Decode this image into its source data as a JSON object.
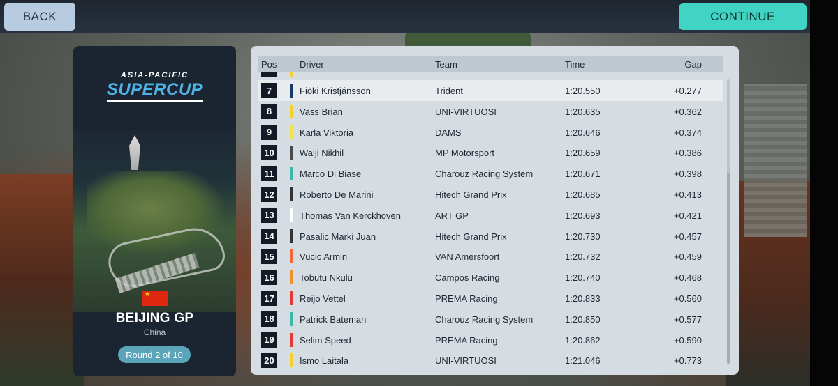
{
  "nav": {
    "back_label": "BACK",
    "continue_label": "CONTINUE"
  },
  "event": {
    "series_top": "ASIA-PACIFIC",
    "series_name": "SUPERCUP",
    "gp_name": "BEIJING GP",
    "country": "China",
    "round": "Round 2 of 10"
  },
  "colors": {
    "continue": "#41d3c3",
    "back": "#b8cce1",
    "series_blue": "#4fb3e6",
    "round_badge": "#5aa5ba"
  },
  "table": {
    "headers": {
      "pos": "Pos",
      "driver": "Driver",
      "team": "Team",
      "time": "Time",
      "gap": "Gap"
    },
    "rows": [
      {
        "pos": "7",
        "driver": "Fiòki Kristjánsson",
        "team": "Trident",
        "time": "1:20.550",
        "gap": "+0.277",
        "color": "#1a3a66"
      },
      {
        "pos": "8",
        "driver": "Vass Brian",
        "team": "UNI-VIRTUOSI",
        "time": "1:20.635",
        "gap": "+0.362",
        "color": "#f2d22a"
      },
      {
        "pos": "9",
        "driver": "Karla Viktoria",
        "team": "DAMS",
        "time": "1:20.646",
        "gap": "+0.374",
        "color": "#f5e04a"
      },
      {
        "pos": "10",
        "driver": "Walji Nikhil",
        "team": "MP Motorsport",
        "time": "1:20.659",
        "gap": "+0.386",
        "color": "#4a4a4a"
      },
      {
        "pos": "11",
        "driver": "Marco Di Biase",
        "team": "Charouz Racing System",
        "time": "1:20.671",
        "gap": "+0.398",
        "color": "#3fb6aa"
      },
      {
        "pos": "12",
        "driver": "Roberto De Marini",
        "team": "Hitech Grand Prix",
        "time": "1:20.685",
        "gap": "+0.413",
        "color": "#333333"
      },
      {
        "pos": "13",
        "driver": "Thomas Van Kerckhoven",
        "team": "ART GP",
        "time": "1:20.693",
        "gap": "+0.421",
        "color": "#ffffff"
      },
      {
        "pos": "14",
        "driver": "Pasalic Marki Juan",
        "team": "Hitech Grand Prix",
        "time": "1:20.730",
        "gap": "+0.457",
        "color": "#333333"
      },
      {
        "pos": "15",
        "driver": "Vucic Armin",
        "team": "VAN Amersfoort",
        "time": "1:20.732",
        "gap": "+0.459",
        "color": "#f06a3b"
      },
      {
        "pos": "16",
        "driver": "Tobutu Nkulu",
        "team": "Campos Racing",
        "time": "1:20.740",
        "gap": "+0.468",
        "color": "#f0902a"
      },
      {
        "pos": "17",
        "driver": "Reijo Vettel",
        "team": "PREMA Racing",
        "time": "1:20.833",
        "gap": "+0.560",
        "color": "#e53a3a"
      },
      {
        "pos": "18",
        "driver": "Patrick Bateman",
        "team": "Charouz Racing System",
        "time": "1:20.850",
        "gap": "+0.577",
        "color": "#3fb6aa"
      },
      {
        "pos": "19",
        "driver": "Selim Speed",
        "team": "PREMA Racing",
        "time": "1:20.862",
        "gap": "+0.590",
        "color": "#e53a3a"
      },
      {
        "pos": "20",
        "driver": "Ismo Laitala",
        "team": "UNI-VIRTUOSI",
        "time": "1:21.046",
        "gap": "+0.773",
        "color": "#f2d22a"
      }
    ]
  }
}
